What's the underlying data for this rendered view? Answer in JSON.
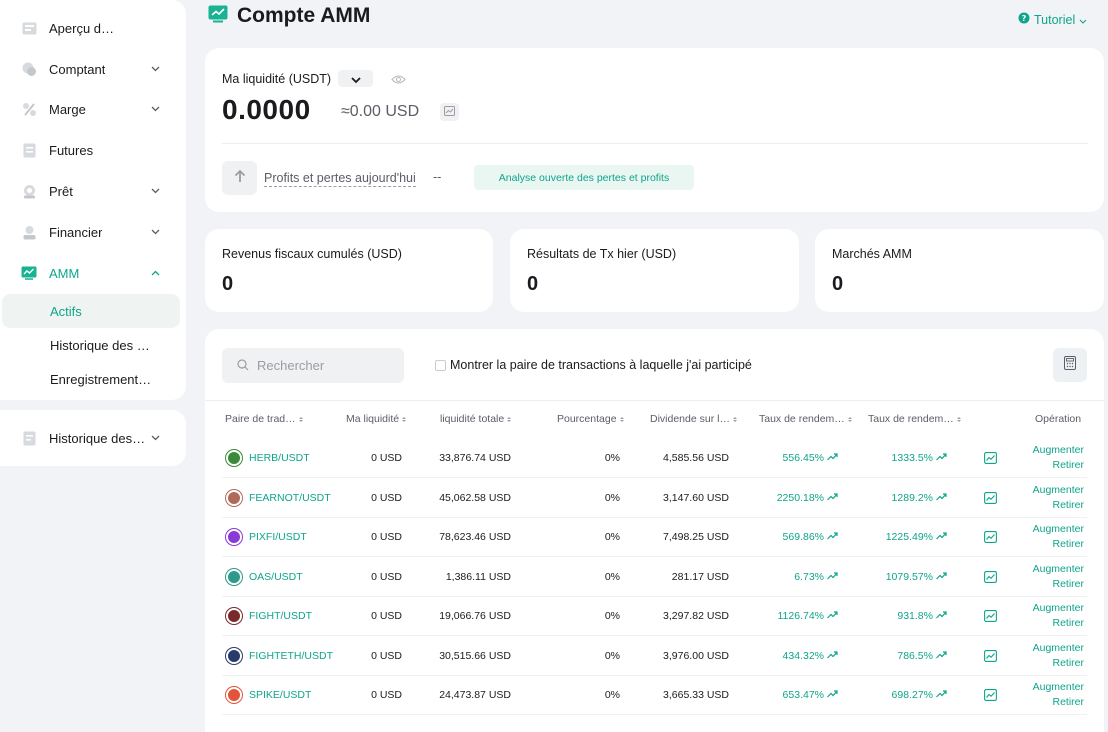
{
  "sidebar": {
    "items": [
      {
        "label": "Aperçu d…",
        "icon": "overview-icon"
      },
      {
        "label": "Comptant",
        "icon": "spot-icon"
      },
      {
        "label": "Marge",
        "icon": "margin-icon"
      },
      {
        "label": "Futures",
        "icon": "futures-icon"
      },
      {
        "label": "Prêt",
        "icon": "loan-icon"
      },
      {
        "label": "Financier",
        "icon": "finance-icon"
      },
      {
        "label": "AMM",
        "icon": "amm-icon"
      }
    ],
    "sub_items": [
      {
        "label": "Actifs"
      },
      {
        "label": "Historique des r…"
      },
      {
        "label": "Enregistrements…"
      }
    ],
    "history": {
      "label": "Historique des…"
    }
  },
  "header": {
    "title": "Compte AMM",
    "tutorial": "Tutoriel"
  },
  "liquidity": {
    "label": "Ma liquidité (USDT)",
    "value": "0.0000",
    "usd": "≈0.00 USD",
    "pnl_label": "Profits et pertes aujourd'hui",
    "pnl_value": "--",
    "pnl_button": "Analyse ouverte des pertes et profits"
  },
  "stats": [
    {
      "label": "Revenus fiscaux cumulés (USD)",
      "value": "0"
    },
    {
      "label": "Résultats de Tx hier (USD)",
      "value": "0"
    },
    {
      "label": "Marchés AMM",
      "value": "0"
    }
  ],
  "table": {
    "search_placeholder": "Rechercher",
    "checkbox_label": "Montrer la paire de transactions à laquelle j'ai participé",
    "headers": [
      "Paire de trad…",
      "Ma liquidité",
      "liquidité totale",
      "Pourcentage",
      "Dividende sur l…",
      "Taux de rendem…",
      "Taux de rendem…",
      "Opération"
    ],
    "op_increase": "Augmenter",
    "op_withdraw": "Retirer",
    "rows": [
      {
        "pair": "HERB/USDT",
        "my": "0 USD",
        "total": "33,876.74 USD",
        "pct": "0%",
        "div": "4,585.56 USD",
        "r1": "556.45%",
        "r2": "1333.5%",
        "color": "#3a8a3a"
      },
      {
        "pair": "FEARNOT/USDT",
        "my": "0 USD",
        "total": "45,062.58 USD",
        "pct": "0%",
        "div": "3,147.60 USD",
        "r1": "2250.18%",
        "r2": "1289.2%",
        "color": "#b06a5a"
      },
      {
        "pair": "PIXFI/USDT",
        "my": "0 USD",
        "total": "78,623.46 USD",
        "pct": "0%",
        "div": "7,498.25 USD",
        "r1": "569.86%",
        "r2": "1225.49%",
        "color": "#8a3ad6"
      },
      {
        "pair": "OAS/USDT",
        "my": "0 USD",
        "total": "1,386.11 USD",
        "pct": "0%",
        "div": "281.17 USD",
        "r1": "6.73%",
        "r2": "1079.57%",
        "color": "#2f9a8a"
      },
      {
        "pair": "FIGHT/USDT",
        "my": "0 USD",
        "total": "19,066.76 USD",
        "pct": "0%",
        "div": "3,297.82 USD",
        "r1": "1126.74%",
        "r2": "931.8%",
        "color": "#7a2a2a"
      },
      {
        "pair": "FIGHTETH/USDT",
        "my": "0 USD",
        "total": "30,515.66 USD",
        "pct": "0%",
        "div": "3,976.00 USD",
        "r1": "434.32%",
        "r2": "786.5%",
        "color": "#2a3a6a"
      },
      {
        "pair": "SPIKE/USDT",
        "my": "0 USD",
        "total": "24,473.87 USD",
        "pct": "0%",
        "div": "3,665.33 USD",
        "r1": "653.47%",
        "r2": "698.27%",
        "color": "#e2553a"
      }
    ]
  },
  "colors": {
    "accent": "#0ea58a",
    "background": "#f1f3f7",
    "card": "#ffffff"
  }
}
